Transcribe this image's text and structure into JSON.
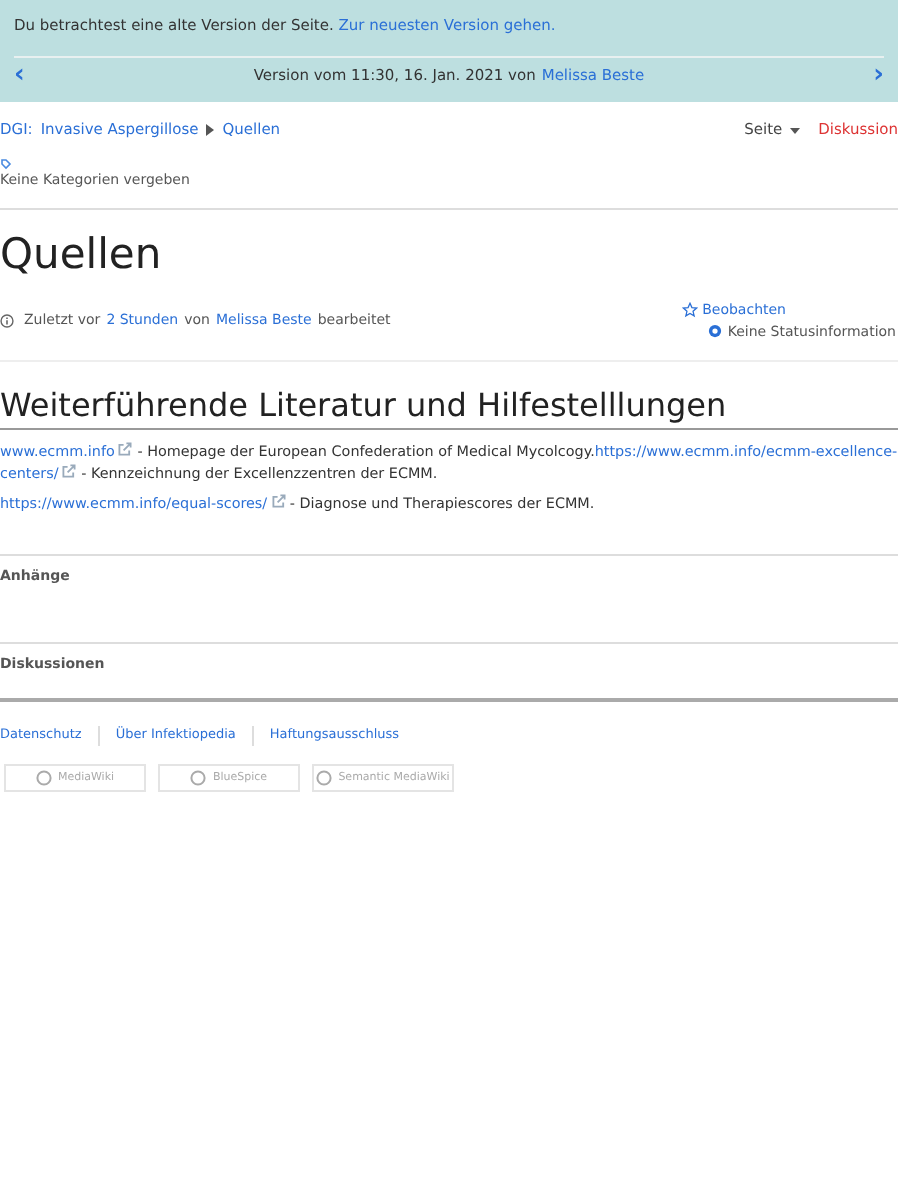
{
  "banner": {
    "notice": "Du betrachtest eine alte Version der Seite.",
    "notice_link": "Zur neuesten Version gehen.",
    "prev": "‹",
    "version_text": "Version vom 11:30, 16. Jan. 2021 von",
    "version_author": "Melissa Beste",
    "next": "›"
  },
  "breadcrumb": [
    "DGI:",
    "Invasive Aspergillose",
    "Quellen"
  ],
  "page_menu": {
    "label": "Seite",
    "discussion": "Diskussion"
  },
  "categories": "Keine Kategorien vergeben",
  "title": "Quellen",
  "meta": {
    "prefix": "Zuletzt vor",
    "time": "2 Stunden",
    "mid": "von",
    "author": "Melissa Beste",
    "suffix": "bearbeitet",
    "watch": "Beobachten",
    "status": "Keine Statusinformation"
  },
  "section_heading": "Weiterführende Literatur und Hilfestelllungen",
  "paragraphs": [
    [
      {
        "link": "www.ecmm.info"
      },
      {
        "text": " - Homepage der European Confederation of Medical Mycolcogy."
      },
      {
        "link": "https://www.ecmm.info/ecmm-excellence-"
      },
      {
        "link": "centers/"
      },
      {
        "text": " - Kennzeichnung der Excellenzzentren der ECMM."
      }
    ],
    [
      {
        "link": "https://www.ecmm.info/equal-scores/"
      },
      {
        "text": " - Diagnose und Therapiescores der ECMM."
      }
    ]
  ],
  "panels": [
    "Anhänge",
    "Diskussionen"
  ],
  "footer_links": [
    "Datenschutz",
    "Über Infektiopedia",
    "Haftungsausschluss"
  ],
  "badges": [
    "MediaWiki",
    "BlueSpice",
    "Semantic MediaWiki"
  ]
}
